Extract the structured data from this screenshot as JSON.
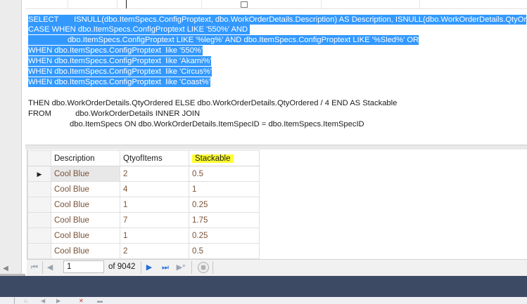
{
  "sql": {
    "lines": [
      "SELECT       ISNULL(dbo.ItemSpecs.ConfigProptext, dbo.WorkOrderDetails.Description) AS Description, ISNULL(dbo.WorkOrderDetails.QtyOr",
      "CASE WHEN dbo.ItemSpecs.ConfigProptext LIKE '550%' AND ",
      "                  dbo.ItemSpecs.ConfigProptext LIKE '%leg%' AND dbo.ItemSpecs.ConfigProptext LIKE '%Sled%' OR",
      "WHEN dbo.ItemSpecs.ConfigProptext  like '550%'",
      "WHEN dbo.ItemSpecs.ConfigProptext  like 'Akami%'",
      "WHEN dbo.ItemSpecs.ConfigProptext  like 'Circus%'",
      "WHEN dbo.ItemSpecs.ConfigProptext  like 'Coast%'",
      "THEN dbo.WorkOrderDetails.QtyOrdered ELSE dbo.WorkOrderDetails.QtyOrdered / 4 END AS Stackable",
      "FROM           dbo.WorkOrderDetails INNER JOIN",
      "                   dbo.ItemSpecs ON dbo.WorkOrderDetails.ItemSpecID = dbo.ItemSpecs.ItemSpecID"
    ]
  },
  "grid": {
    "columns": [
      "Description",
      "QtyofItems",
      "Stackable"
    ],
    "rows": [
      [
        "Cool Blue",
        "2",
        "0.5"
      ],
      [
        "Cool Blue",
        "4",
        "1"
      ],
      [
        "Cool Blue",
        "1",
        "0.25"
      ],
      [
        "Cool Blue",
        "7",
        "1.75"
      ],
      [
        "Cool Blue",
        "1",
        "0.25"
      ],
      [
        "Cool Blue",
        "2",
        "0.5"
      ]
    ],
    "current_row_marker": "▶"
  },
  "navigation": {
    "first_icon": "first-page-icon",
    "prev_icon": "previous-page-icon",
    "page_value": "1",
    "page_total": "of 9042",
    "next_icon": "next-page-icon",
    "last_icon": "last-page-icon",
    "new_icon": "new-row-icon",
    "stop_icon": "stop-icon"
  },
  "colors": {
    "selection": "#3399ff",
    "highlight": "#ffff33",
    "cell_text": "#7a5135",
    "band": "#3d4a64"
  }
}
